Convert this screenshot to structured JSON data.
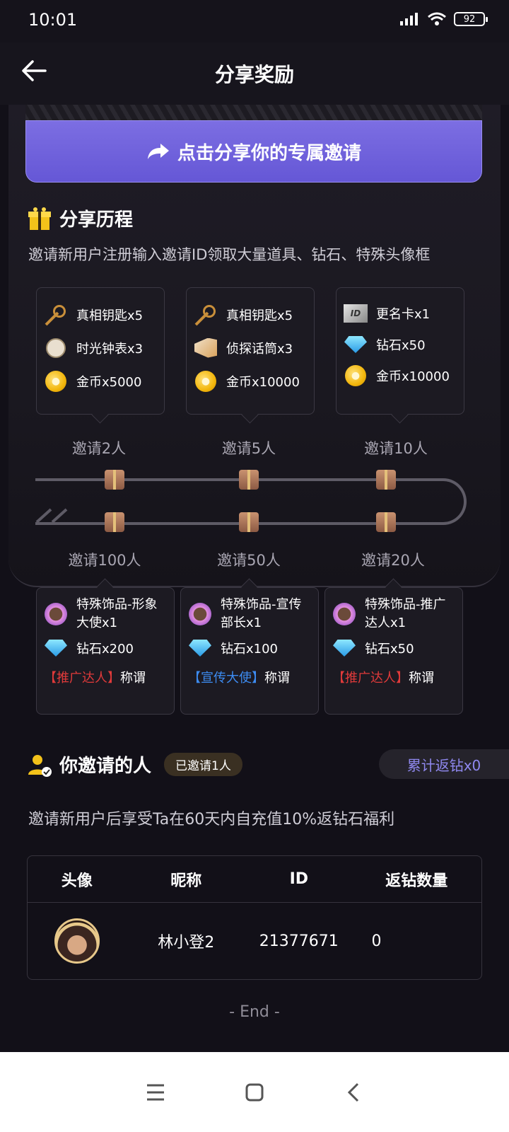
{
  "status_bar": {
    "time": "10:01",
    "battery": "92"
  },
  "header": {
    "title": "分享奖励"
  },
  "share_button": {
    "label": "点击分享你的专属邀请"
  },
  "share_history": {
    "title": "分享历程",
    "description": "邀请新用户注册输入邀请ID领取大量道具、钻石、特殊头像框",
    "top_cards": [
      {
        "items": [
          {
            "icon": "key-icon",
            "text": "真相钥匙x5"
          },
          {
            "icon": "clock-icon",
            "text": "时光钟表x3"
          },
          {
            "icon": "coin-icon",
            "text": "金币x5000"
          }
        ],
        "milestone": "邀请2人"
      },
      {
        "items": [
          {
            "icon": "key-icon",
            "text": "真相钥匙x5"
          },
          {
            "icon": "megaphone-icon",
            "text": "侦探话筒x3"
          },
          {
            "icon": "coin-icon",
            "text": "金币x10000"
          }
        ],
        "milestone": "邀请5人"
      },
      {
        "items": [
          {
            "icon": "id-card-icon",
            "text": "更名卡x1"
          },
          {
            "icon": "diamond-icon",
            "text": "钻石x50"
          },
          {
            "icon": "coin-icon",
            "text": "金币x10000"
          }
        ],
        "milestone": "邀请10人"
      }
    ],
    "bottom_cards": [
      {
        "milestone": "邀请100人",
        "frame_text": "特殊饰品-形象大使x1",
        "diamond_text": "钻石x200",
        "badge": "【推广达人】",
        "badge_suffix": "称谓",
        "badge_color": "#e03a3a"
      },
      {
        "milestone": "邀请50人",
        "frame_text": "特殊饰品-宣传部长x1",
        "diamond_text": "钻石x100",
        "badge": "【宣传大使】",
        "badge_suffix": "称谓",
        "badge_color": "#3d8cf2"
      },
      {
        "milestone": "邀请20人",
        "frame_text": "特殊饰品-推广达人x1",
        "diamond_text": "钻石x50",
        "badge": "【推广达人】",
        "badge_suffix": "称谓",
        "badge_color": "#e03a3a"
      }
    ]
  },
  "invited": {
    "title": "你邀请的人",
    "count_badge": "已邀请1人",
    "rebate": "累计返钻x0",
    "description": "邀请新用户后享受Ta在60天内自充值10%返钻石福利",
    "table": {
      "headers": [
        "头像",
        "昵称",
        "ID",
        "返钻数量"
      ],
      "rows": [
        {
          "nickname": "林小登2",
          "id": "21377671",
          "rebate": "0"
        }
      ]
    }
  },
  "end_text": "- End -",
  "colors": {
    "accent": "#6f62dc",
    "rebate_text": "#8f88ef",
    "background": "#121018"
  }
}
